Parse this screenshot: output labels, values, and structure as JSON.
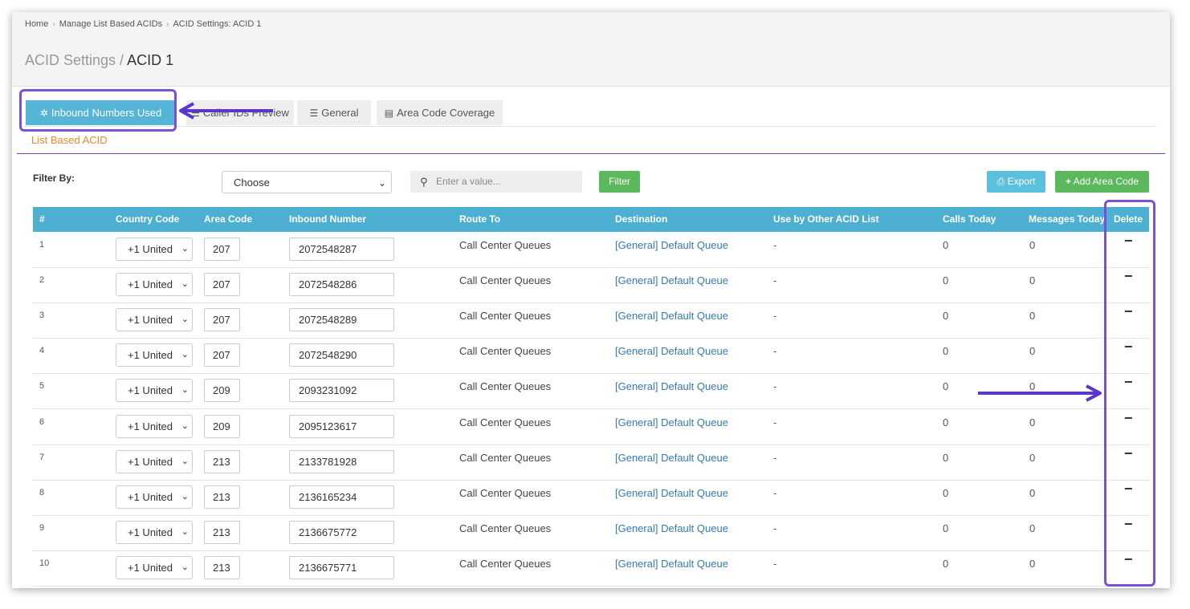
{
  "breadcrumb": [
    "Home",
    "Manage List Based ACIDs",
    "ACID Settings: ACID 1"
  ],
  "page_title": {
    "parent": "ACID Settings / ",
    "current": "ACID 1"
  },
  "tabs": [
    {
      "label": "Inbound Numbers Used",
      "icon": "gear-icon",
      "active": true
    },
    {
      "label": "Caller IDs Preview",
      "icon": "list-icon",
      "active": false
    },
    {
      "label": "General",
      "icon": "list-ordered-icon",
      "active": false
    },
    {
      "label": "Area Code Coverage",
      "icon": "file-icon",
      "active": false
    }
  ],
  "subheading": "List Based ACID",
  "filter": {
    "label": "Filter By:",
    "select_value": "Choose",
    "search_placeholder": "Enter a value...",
    "filter_button": "Filter",
    "export_button": "Export",
    "add_button": "Add Area Code"
  },
  "table": {
    "headers": [
      "#",
      "Country Code",
      "Area Code",
      "Inbound Number",
      "Route To",
      "Destination",
      "Use by Other ACID List",
      "Calls Today",
      "Messages Today",
      "Delete"
    ],
    "rows": [
      {
        "num": "1",
        "country": "+1 United",
        "area": "207",
        "inbound": "2072548287",
        "route": "Call Center Queues",
        "dest": "[General] Default Queue",
        "other": "-",
        "calls": "0",
        "msgs": "0",
        "del": "−"
      },
      {
        "num": "2",
        "country": "+1 United",
        "area": "207",
        "inbound": "2072548286",
        "route": "Call Center Queues",
        "dest": "[General] Default Queue",
        "other": "-",
        "calls": "0",
        "msgs": "0",
        "del": "−"
      },
      {
        "num": "3",
        "country": "+1 United",
        "area": "207",
        "inbound": "2072548289",
        "route": "Call Center Queues",
        "dest": "[General] Default Queue",
        "other": "-",
        "calls": "0",
        "msgs": "0",
        "del": "−"
      },
      {
        "num": "4",
        "country": "+1 United",
        "area": "207",
        "inbound": "2072548290",
        "route": "Call Center Queues",
        "dest": "[General] Default Queue",
        "other": "-",
        "calls": "0",
        "msgs": "0",
        "del": "−"
      },
      {
        "num": "5",
        "country": "+1 United",
        "area": "209",
        "inbound": "2093231092",
        "route": "Call Center Queues",
        "dest": "[General] Default Queue",
        "other": "-",
        "calls": "0",
        "msgs": "0",
        "del": "−"
      },
      {
        "num": "6",
        "country": "+1 United",
        "area": "209",
        "inbound": "2095123617",
        "route": "Call Center Queues",
        "dest": "[General] Default Queue",
        "other": "-",
        "calls": "0",
        "msgs": "0",
        "del": "−"
      },
      {
        "num": "7",
        "country": "+1 United",
        "area": "213",
        "inbound": "2133781928",
        "route": "Call Center Queues",
        "dest": "[General] Default Queue",
        "other": "-",
        "calls": "0",
        "msgs": "0",
        "del": "−"
      },
      {
        "num": "8",
        "country": "+1 United",
        "area": "213",
        "inbound": "2136165234",
        "route": "Call Center Queues",
        "dest": "[General] Default Queue",
        "other": "-",
        "calls": "0",
        "msgs": "0",
        "del": "−"
      },
      {
        "num": "9",
        "country": "+1 United",
        "area": "213",
        "inbound": "2136675772",
        "route": "Call Center Queues",
        "dest": "[General] Default Queue",
        "other": "-",
        "calls": "0",
        "msgs": "0",
        "del": "−"
      },
      {
        "num": "10",
        "country": "+1 United",
        "area": "213",
        "inbound": "2136675771",
        "route": "Call Center Queues",
        "dest": "[General] Default Queue",
        "other": "-",
        "calls": "0",
        "msgs": "0",
        "del": "−"
      }
    ]
  },
  "colors": {
    "header_bg": "#4db0d3",
    "active_tab": "#54b5d6",
    "green": "#5cb85c",
    "annotation": "#7b4fd8",
    "subheading": "#e8892b",
    "link": "#337ab7"
  }
}
